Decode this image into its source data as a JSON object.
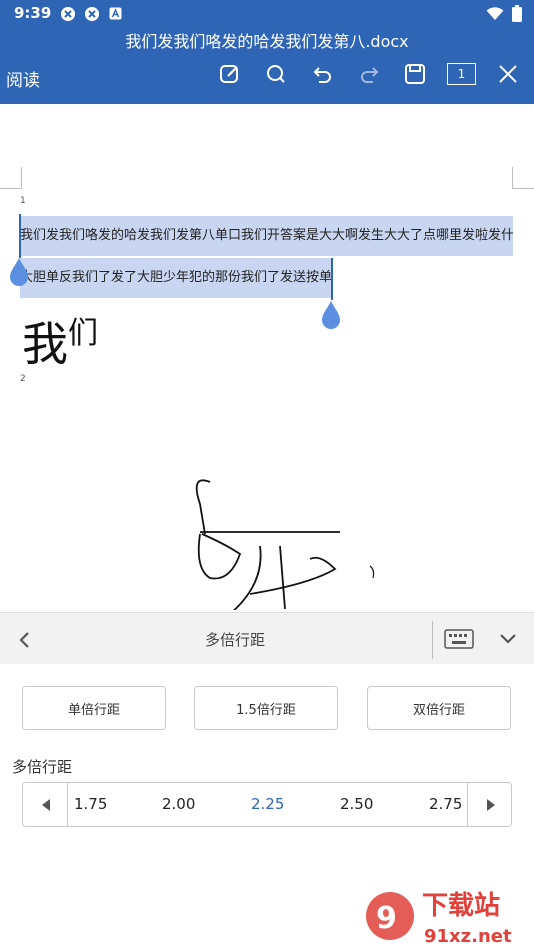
{
  "status": {
    "time": "9:39"
  },
  "header": {
    "doc_title": "我们发我们咯发的哈发我们发第八.docx",
    "mode_label": "阅读",
    "page_indicator": "1"
  },
  "document": {
    "page1_number": "1",
    "page2_number": "2",
    "line1": "我们发我们咯发的哈发我们发第八单口我们开答案是大大啊发生大大了点哪里发啦发什么",
    "line2": "大胆单反我们了发了大胆少年犯的那份我们了发送按单发",
    "big_text_main": "我",
    "big_text_small": "们"
  },
  "panel": {
    "title": "多倍行距",
    "buttons": [
      "单倍行距",
      "1.5倍行距",
      "双倍行距"
    ],
    "section_label": "多倍行距",
    "values": [
      "1.75",
      "2.00",
      "2.25",
      "2.50",
      "2.75"
    ],
    "selected_value": "2.25"
  },
  "watermark": {
    "brand": "下载站",
    "url": "91xz.net"
  },
  "colors": {
    "accent": "#2f65b5",
    "selection": "#c8d6f2"
  }
}
